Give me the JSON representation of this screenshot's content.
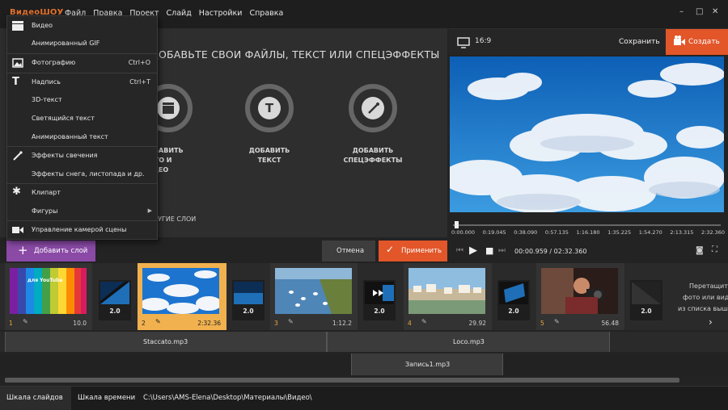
{
  "titlebar": {
    "brand": "ВидеоШОУ",
    "menu": [
      "Файл",
      "Правка",
      "Проект",
      "Слайд",
      "Настройки",
      "Справка"
    ],
    "window_controls": [
      "–",
      "□",
      "✕"
    ]
  },
  "left_panel": {
    "title": "ДОБАВЬТЕ СВОИ ФАЙЛЫ, ТЕКСТ ИЛИ СПЕЦЭФФЕКТЫ",
    "cards": [
      {
        "line1": "ДОБАВИТЬ",
        "line2": "ФОТО И ВИДЕО",
        "icon": "clapper-icon"
      },
      {
        "line1": "ДОБАВИТЬ",
        "line2": "ТЕКСТ",
        "icon": "text-icon"
      },
      {
        "line1": "ДОБАВИТЬ",
        "line2": "СПЕЦЭФФЕКТЫ",
        "icon": "magic-wand-icon"
      }
    ],
    "other_layers": "ДРУГИЕ СЛОИ"
  },
  "dropdown": {
    "items": [
      {
        "label": "Видео",
        "icon": "clapper-icon",
        "shortcut": ""
      },
      {
        "label": "Анимированный GIF",
        "icon": "",
        "shortcut": ""
      },
      {
        "label": "Фотографию",
        "icon": "image-icon",
        "shortcut": "Ctrl+O"
      },
      {
        "label": "Надпись",
        "icon": "text-icon",
        "shortcut": "Ctrl+T"
      },
      {
        "label": "3D-текст",
        "icon": "",
        "shortcut": ""
      },
      {
        "label": "Светящийся текст",
        "icon": "",
        "shortcut": ""
      },
      {
        "label": "Анимированный текст",
        "icon": "",
        "shortcut": ""
      },
      {
        "label": "Эффекты свечения",
        "icon": "magic-wand-icon",
        "shortcut": ""
      },
      {
        "label": "Эффекты снега, листопада и др.",
        "icon": "",
        "shortcut": ""
      },
      {
        "label": "Клипарт",
        "icon": "gear-icon",
        "shortcut": ""
      },
      {
        "label": "Фигуры",
        "icon": "",
        "shortcut": "",
        "submenu": "▶"
      },
      {
        "label": "Управление камерой сцены",
        "icon": "camera-icon",
        "shortcut": ""
      }
    ]
  },
  "preview": {
    "ratio": "16:9",
    "save": "Сохранить",
    "create": "Создать",
    "ticks": [
      "0:00.000",
      "0:19.045",
      "0:38.090",
      "0:57.135",
      "1:16.180",
      "1:35.225",
      "1:54.270",
      "2:13.315",
      "2:32.360"
    ],
    "time": "00:00.959 / 02:32.360",
    "playhead_fraction": 0.006
  },
  "controls": {
    "add_layer": "Добавить слой",
    "cancel": "Отмена",
    "apply": "Применить"
  },
  "slides": [
    {
      "num": "1",
      "duration": "10.0",
      "thumb_text": "для YouTube",
      "type": "rainbow"
    },
    {
      "num": "2",
      "duration": "2:32.36",
      "type": "sky",
      "selected": true
    },
    {
      "num": "3",
      "duration": "1:12.2",
      "type": "swans"
    },
    {
      "num": "4",
      "duration": "29.92",
      "type": "city"
    },
    {
      "num": "5",
      "duration": "56.48",
      "type": "photographer"
    }
  ],
  "transitions": [
    "2.0",
    "2.0",
    "2.0",
    "2.0",
    "2.0"
  ],
  "drop_hint": [
    "Перетащите",
    "фото или видео",
    "из списка выше"
  ],
  "audio": {
    "track1": [
      {
        "name": "Staccato.mp3"
      },
      {
        "name": "Loco.mp3"
      }
    ],
    "track2": [
      {
        "name": "Запись1.mp3"
      }
    ]
  },
  "statusbar": {
    "tab_slides": "Шкала слайдов",
    "tab_timeline": "Шкала времени",
    "path": "C:\\Users\\AMS-Elena\\Desktop\\Материалы\\Видео\\"
  }
}
